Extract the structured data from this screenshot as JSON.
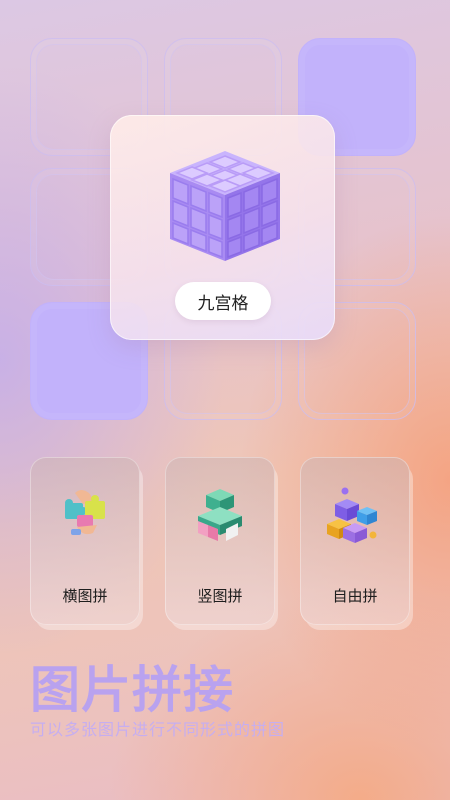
{
  "hero": {
    "label": "九宫格"
  },
  "modes": [
    {
      "label": "横图拼"
    },
    {
      "label": "竖图拼"
    },
    {
      "label": "自由拼"
    }
  ],
  "headline": "图片拼接",
  "subtitle": "可以多张图片进行不同形式的拼图",
  "colors": {
    "accent": "#c2b2fb",
    "headline": "#b9a2ef",
    "subtitle": "#c6aef0",
    "cube": "#b79af8"
  },
  "icons": {
    "hero": "rubiks-cube-icon",
    "horizontal": "puzzle-hand-icon",
    "vertical": "stacked-blocks-icon",
    "free": "colored-cubes-icon"
  }
}
